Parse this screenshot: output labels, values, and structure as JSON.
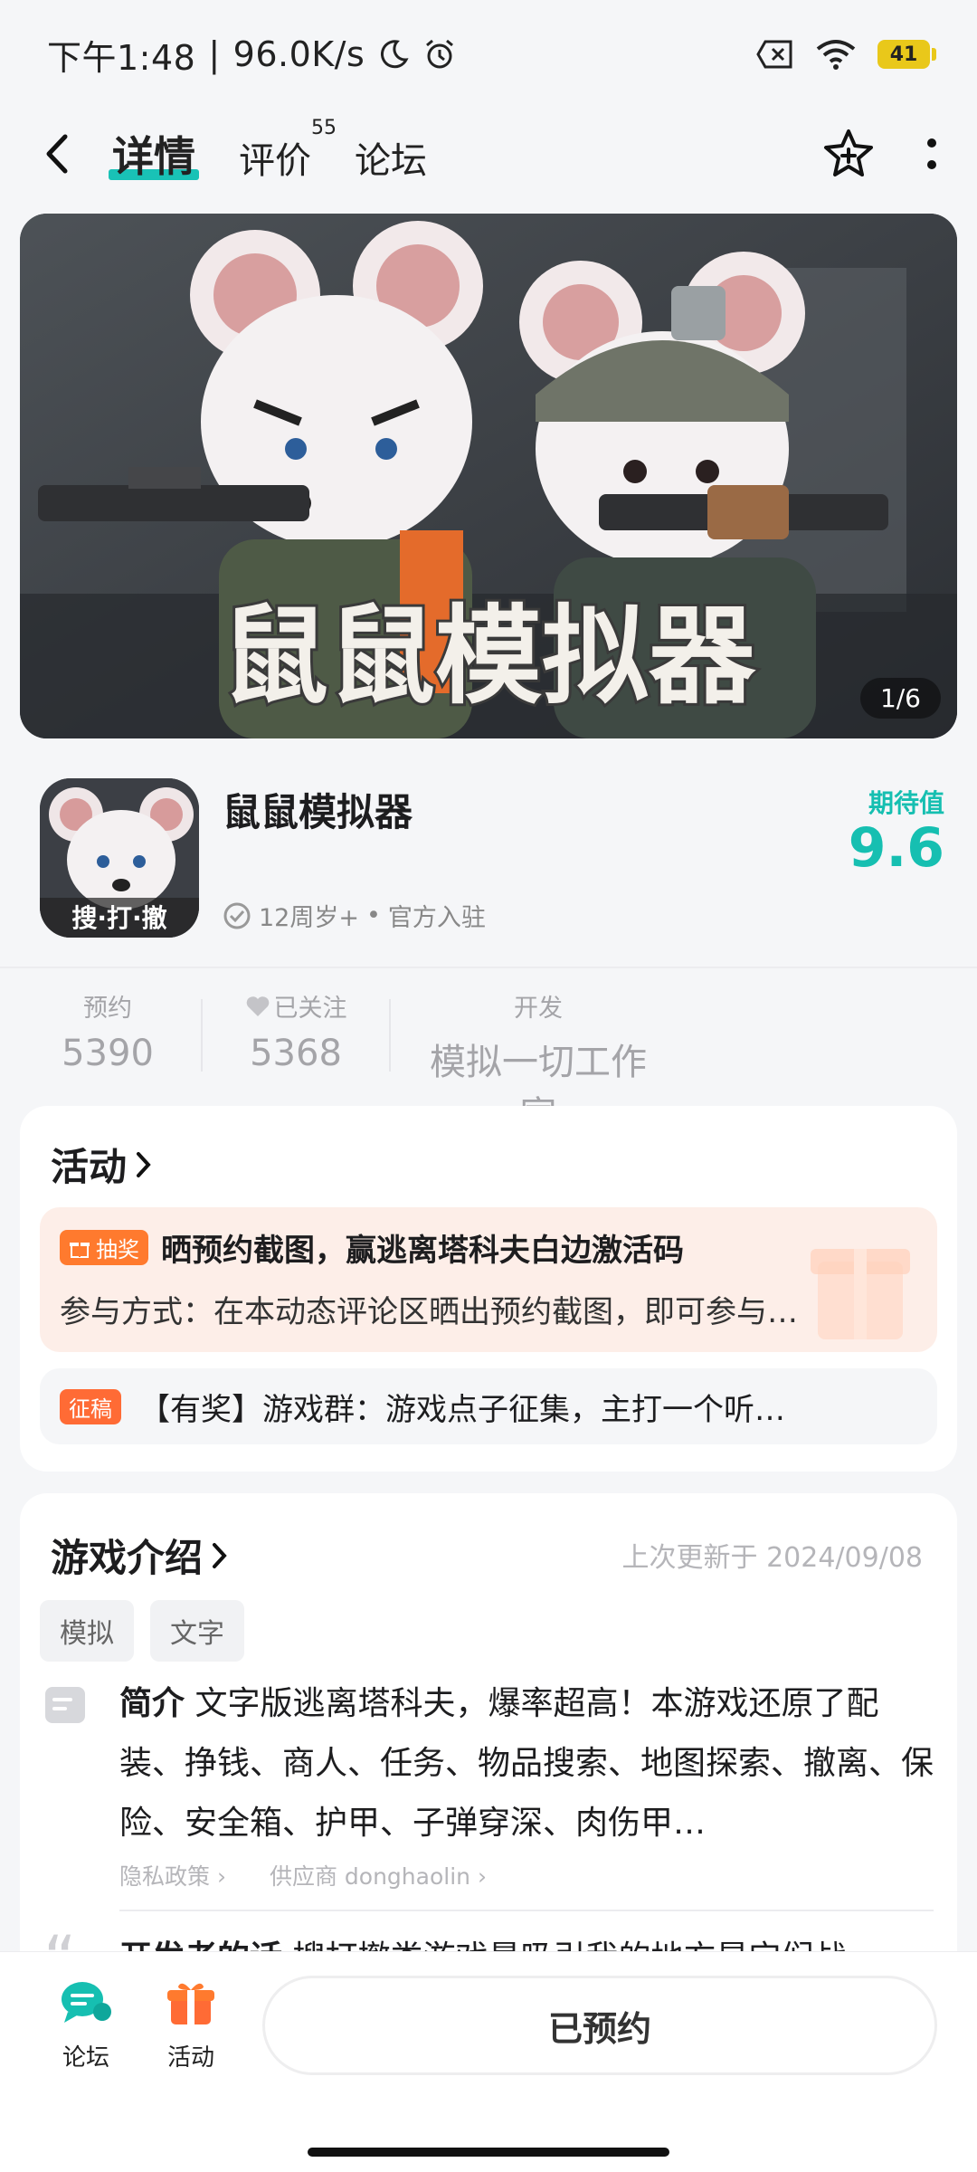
{
  "status_bar": {
    "time": "下午1:48",
    "separator": "|",
    "net_speed": "96.0K/s",
    "battery": "41"
  },
  "nav": {
    "tabs": [
      {
        "label": "详情",
        "active": true
      },
      {
        "label": "评价",
        "count": "55"
      },
      {
        "label": "论坛"
      }
    ]
  },
  "banner": {
    "title": "鼠鼠模拟器",
    "page_indicator": "1/6"
  },
  "app": {
    "name": "鼠鼠模拟器",
    "icon_caption": "搜·打·撤",
    "age_rating": "12周岁+",
    "dot": "•",
    "official": "官方入驻",
    "expectation_label": "期待值",
    "expectation_value": "9.6"
  },
  "stats": [
    {
      "label": "预约",
      "value": "5390"
    },
    {
      "label": "已关注",
      "value": "5368",
      "icon": "heart-icon"
    },
    {
      "label": "开发",
      "value": "模拟一切工作室"
    }
  ],
  "activities": {
    "title": "活动",
    "items": [
      {
        "badge": "抽奖",
        "badge_icon": "gift-icon",
        "headline": "晒预约截图，赢逃离塔科夫白边激活码",
        "detail": "参与方式：在本动态评论区晒出预约截图，即可参与…"
      },
      {
        "badge": "征稿",
        "headline": "【有奖】游戏群：游戏点子征集，主打一个听…"
      }
    ]
  },
  "intro": {
    "title": "游戏介绍",
    "updated": "上次更新于 2024/09/08",
    "tags": [
      "模拟",
      "文字"
    ],
    "summary_label": "简介",
    "summary": "文字版逃离塔科夫，爆率超高！本游戏还原了配装、挣钱、商人、任务、物品搜索、地图探索、撤离、保险、安全箱、护甲、子弹穿深、肉伤甲…",
    "privacy_link": "隐私政策",
    "supplier_link": "供应商 donghaolin",
    "dev_words_label": "开发者的话",
    "dev_words": "搜打撤类游戏最吸引我的地方是它们战"
  },
  "bottom": {
    "forum_label": "论坛",
    "activity_label": "活动",
    "reserve_label": "已预约"
  },
  "colors": {
    "accent": "#16bfb1",
    "lottery_orange": "#ff7a2e",
    "lottery_bg": "#fdeee8",
    "submission_bg": "#f5f6f8"
  }
}
